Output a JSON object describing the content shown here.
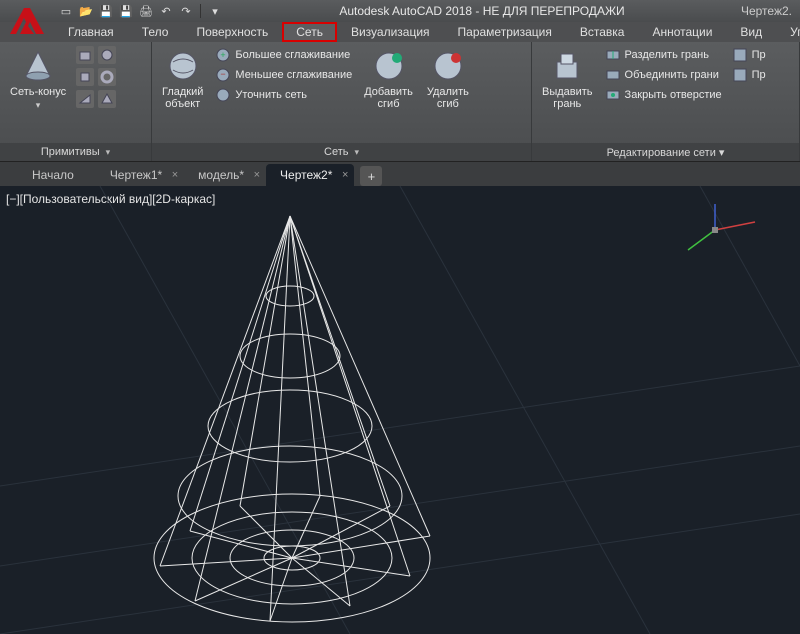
{
  "title_bar": {
    "app_title": "Autodesk AutoCAD 2018 - НЕ ДЛЯ ПЕРЕПРОДАЖИ",
    "doc_name": "Чертеж2."
  },
  "menu": {
    "items": [
      "Главная",
      "Тело",
      "Поверхность",
      "Сеть",
      "Визуализация",
      "Параметризация",
      "Вставка",
      "Аннотации",
      "Вид",
      "Упр"
    ],
    "highlighted_index": 3
  },
  "ribbon": {
    "primitives": {
      "title": "Примитивы",
      "cone_label": "Сеть-конус"
    },
    "mesh": {
      "title": "Сеть",
      "smooth_label": "Гладкий\nобъект",
      "more_smooth": "Большее сглаживание",
      "less_smooth": "Меньшее сглаживание",
      "refine": "Уточнить сеть",
      "add_crease": "Добавить\nсгиб",
      "remove_crease": "Удалить\nсгиб"
    },
    "edit": {
      "title": "Редактирование сети ▾",
      "extrude": "Выдавить\nгрань",
      "split": "Разделить грань",
      "merge": "Объединить грани",
      "close": "Закрыть отверстие",
      "pr1": "Пр",
      "pr2": "Пр"
    }
  },
  "tabs": {
    "items": [
      {
        "label": "Начало",
        "closable": false,
        "active": false
      },
      {
        "label": "Чертеж1*",
        "closable": true,
        "active": false
      },
      {
        "label": "модель*",
        "closable": true,
        "active": false
      },
      {
        "label": "Чертеж2*",
        "closable": true,
        "active": true
      }
    ]
  },
  "viewport": {
    "label": "[−][Пользовательский вид][2D-каркас]"
  }
}
